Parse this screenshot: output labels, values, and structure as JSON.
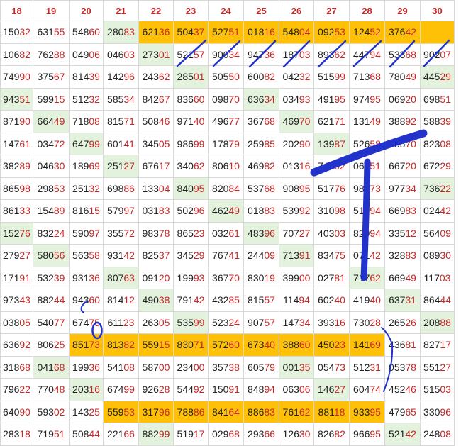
{
  "headers": [
    "18",
    "19",
    "20",
    "21",
    "22",
    "23",
    "24",
    "25",
    "26",
    "27",
    "28",
    "29",
    "30"
  ],
  "rows": [
    [
      {
        "v": "15032"
      },
      {
        "v": "63155"
      },
      {
        "v": "54860"
      },
      {
        "v": "28083",
        "b": "g"
      },
      {
        "v": "62136",
        "b": "o"
      },
      {
        "v": "50437",
        "b": "o"
      },
      {
        "v": "52751",
        "b": "o"
      },
      {
        "v": "01816",
        "b": "o"
      },
      {
        "v": "54804",
        "b": "o"
      },
      {
        "v": "09253",
        "b": "o"
      },
      {
        "v": "12452",
        "b": "o"
      },
      {
        "v": "37642",
        "b": "o"
      },
      {
        "v": "",
        "b": "o"
      }
    ],
    [
      {
        "v": "10682"
      },
      {
        "v": "76288"
      },
      {
        "v": "04906"
      },
      {
        "v": "04603"
      },
      {
        "v": "27301",
        "b": "g"
      },
      {
        "v": "52157"
      },
      {
        "v": "90034"
      },
      {
        "v": "94736"
      },
      {
        "v": "18703"
      },
      {
        "v": "89362"
      },
      {
        "v": "44794"
      },
      {
        "v": "53368"
      },
      {
        "v": "90207"
      }
    ],
    [
      {
        "v": "74990"
      },
      {
        "v": "37567"
      },
      {
        "v": "81439"
      },
      {
        "v": "14296"
      },
      {
        "v": "24362"
      },
      {
        "v": "28501",
        "b": "g"
      },
      {
        "v": "50550"
      },
      {
        "v": "60082"
      },
      {
        "v": "04232"
      },
      {
        "v": "51599"
      },
      {
        "v": "71368"
      },
      {
        "v": "78049"
      },
      {
        "v": "44529",
        "b": "g"
      }
    ],
    [
      {
        "v": "94351",
        "b": "g"
      },
      {
        "v": "59915"
      },
      {
        "v": "51232"
      },
      {
        "v": "58534"
      },
      {
        "v": "84267"
      },
      {
        "v": "83660"
      },
      {
        "v": "09870"
      },
      {
        "v": "63634",
        "b": "g"
      },
      {
        "v": "03493"
      },
      {
        "v": "49195"
      },
      {
        "v": "97495"
      },
      {
        "v": "06920"
      },
      {
        "v": "69851"
      }
    ],
    [
      {
        "v": "87190"
      },
      {
        "v": "66449",
        "b": "g"
      },
      {
        "v": "71808"
      },
      {
        "v": "81571"
      },
      {
        "v": "50846"
      },
      {
        "v": "97140"
      },
      {
        "v": "49677"
      },
      {
        "v": "36768"
      },
      {
        "v": "46970",
        "b": "g"
      },
      {
        "v": "62171"
      },
      {
        "v": "13149"
      },
      {
        "v": "38892"
      },
      {
        "v": "58839"
      }
    ],
    [
      {
        "v": "14761"
      },
      {
        "v": "03472"
      },
      {
        "v": "64799",
        "b": "g"
      },
      {
        "v": "60141"
      },
      {
        "v": "34505"
      },
      {
        "v": "98699"
      },
      {
        "v": "17879"
      },
      {
        "v": "25985"
      },
      {
        "v": "20290"
      },
      {
        "v": "13987",
        "b": "g"
      },
      {
        "v": "52658"
      },
      {
        "v": "95570"
      },
      {
        "v": "82308"
      }
    ],
    [
      {
        "v": "38289"
      },
      {
        "v": "04630"
      },
      {
        "v": "18969"
      },
      {
        "v": "25127",
        "b": "g"
      },
      {
        "v": "67617"
      },
      {
        "v": "34062"
      },
      {
        "v": "80610"
      },
      {
        "v": "46982"
      },
      {
        "v": "01316"
      },
      {
        "v": "74392"
      },
      {
        "v": "06651"
      },
      {
        "v": "66720"
      },
      {
        "v": "67229"
      }
    ],
    [
      {
        "v": "86598"
      },
      {
        "v": "29853"
      },
      {
        "v": "25132"
      },
      {
        "v": "69886"
      },
      {
        "v": "13304"
      },
      {
        "v": "84095",
        "b": "g"
      },
      {
        "v": "82084"
      },
      {
        "v": "53768"
      },
      {
        "v": "90895"
      },
      {
        "v": "51776"
      },
      {
        "v": "98973"
      },
      {
        "v": "97734"
      },
      {
        "v": "73622",
        "b": "g"
      }
    ],
    [
      {
        "v": "86133"
      },
      {
        "v": "15489"
      },
      {
        "v": "81615"
      },
      {
        "v": "57997"
      },
      {
        "v": "03183"
      },
      {
        "v": "50296"
      },
      {
        "v": "46249",
        "b": "g"
      },
      {
        "v": "01883"
      },
      {
        "v": "53992"
      },
      {
        "v": "31098"
      },
      {
        "v": "51994"
      },
      {
        "v": "66983"
      },
      {
        "v": "02442"
      }
    ],
    [
      {
        "v": "15276",
        "b": "g"
      },
      {
        "v": "83224"
      },
      {
        "v": "59097"
      },
      {
        "v": "35572"
      },
      {
        "v": "98378"
      },
      {
        "v": "86523"
      },
      {
        "v": "03261"
      },
      {
        "v": "48396",
        "b": "g"
      },
      {
        "v": "70727"
      },
      {
        "v": "40303"
      },
      {
        "v": "82994"
      },
      {
        "v": "33512"
      },
      {
        "v": "56409"
      }
    ],
    [
      {
        "v": "27927"
      },
      {
        "v": "58056",
        "b": "g"
      },
      {
        "v": "56358"
      },
      {
        "v": "93142"
      },
      {
        "v": "82537"
      },
      {
        "v": "34529"
      },
      {
        "v": "76741"
      },
      {
        "v": "24409"
      },
      {
        "v": "71391",
        "b": "g"
      },
      {
        "v": "83475"
      },
      {
        "v": "07142"
      },
      {
        "v": "32883"
      },
      {
        "v": "08930"
      }
    ],
    [
      {
        "v": "17191"
      },
      {
        "v": "53239"
      },
      {
        "v": "93136"
      },
      {
        "v": "80763",
        "b": "g"
      },
      {
        "v": "09120"
      },
      {
        "v": "19993"
      },
      {
        "v": "36770"
      },
      {
        "v": "83019"
      },
      {
        "v": "39900"
      },
      {
        "v": "02781"
      },
      {
        "v": "71762",
        "b": "g"
      },
      {
        "v": "66949"
      },
      {
        "v": "11703"
      }
    ],
    [
      {
        "v": "97343"
      },
      {
        "v": "88244"
      },
      {
        "v": "94360"
      },
      {
        "v": "81412"
      },
      {
        "v": "49038",
        "b": "g"
      },
      {
        "v": "79142"
      },
      {
        "v": "43285"
      },
      {
        "v": "81557"
      },
      {
        "v": "11494"
      },
      {
        "v": "60240"
      },
      {
        "v": "41940"
      },
      {
        "v": "63731",
        "b": "g"
      },
      {
        "v": "86444"
      }
    ],
    [
      {
        "v": "03805"
      },
      {
        "v": "54077"
      },
      {
        "v": "67475"
      },
      {
        "v": "61123"
      },
      {
        "v": "26305"
      },
      {
        "v": "53599",
        "b": "g"
      },
      {
        "v": "52324"
      },
      {
        "v": "90757"
      },
      {
        "v": "14734"
      },
      {
        "v": "39316"
      },
      {
        "v": "73028"
      },
      {
        "v": "26526"
      },
      {
        "v": "20888",
        "b": "g"
      }
    ],
    [
      {
        "v": "63692"
      },
      {
        "v": "80625"
      },
      {
        "v": "85173",
        "b": "o"
      },
      {
        "v": "81382",
        "b": "o"
      },
      {
        "v": "55915",
        "b": "o"
      },
      {
        "v": "83071",
        "b": "o"
      },
      {
        "v": "57260",
        "b": "o"
      },
      {
        "v": "67340",
        "b": "o"
      },
      {
        "v": "38860",
        "b": "o"
      },
      {
        "v": "45023",
        "b": "o"
      },
      {
        "v": "14169",
        "b": "o"
      },
      {
        "v": "43681"
      },
      {
        "v": "82717"
      }
    ],
    [
      {
        "v": "31868"
      },
      {
        "v": "04168",
        "b": "g"
      },
      {
        "v": "19936"
      },
      {
        "v": "54108"
      },
      {
        "v": "58700"
      },
      {
        "v": "23400"
      },
      {
        "v": "35738"
      },
      {
        "v": "60579"
      },
      {
        "v": "00135",
        "b": "g"
      },
      {
        "v": "05473"
      },
      {
        "v": "51231"
      },
      {
        "v": "05378"
      },
      {
        "v": "55127"
      }
    ],
    [
      {
        "v": "79622"
      },
      {
        "v": "77048"
      },
      {
        "v": "20316",
        "b": "g"
      },
      {
        "v": "67499"
      },
      {
        "v": "92628"
      },
      {
        "v": "54492"
      },
      {
        "v": "15091"
      },
      {
        "v": "84894"
      },
      {
        "v": "06306"
      },
      {
        "v": "14627",
        "b": "g"
      },
      {
        "v": "60474"
      },
      {
        "v": "45246"
      },
      {
        "v": "51503"
      }
    ],
    [
      {
        "v": "64090"
      },
      {
        "v": "59302"
      },
      {
        "v": "14325"
      },
      {
        "v": "55953",
        "b": "o"
      },
      {
        "v": "31796",
        "b": "o"
      },
      {
        "v": "78886",
        "b": "o"
      },
      {
        "v": "84164",
        "b": "o"
      },
      {
        "v": "88683",
        "b": "o"
      },
      {
        "v": "76162",
        "b": "o"
      },
      {
        "v": "88118",
        "b": "o"
      },
      {
        "v": "93395",
        "b": "o"
      },
      {
        "v": "47965"
      },
      {
        "v": "33096"
      }
    ],
    [
      {
        "v": "28318"
      },
      {
        "v": "71951"
      },
      {
        "v": "50844"
      },
      {
        "v": "22166"
      },
      {
        "v": "88299",
        "b": "g"
      },
      {
        "v": "51917"
      },
      {
        "v": "02968"
      },
      {
        "v": "29366"
      },
      {
        "v": "12630"
      },
      {
        "v": "82682"
      },
      {
        "v": "96695"
      },
      {
        "v": "52142",
        "b": "g"
      },
      {
        "v": "24808"
      }
    ]
  ],
  "colors": {
    "header_text": "#c62828",
    "tail_text": "#c62828",
    "green_cell": "#e3f2dc",
    "orange_cell": "#ffc107",
    "ink": "#2233cc"
  }
}
